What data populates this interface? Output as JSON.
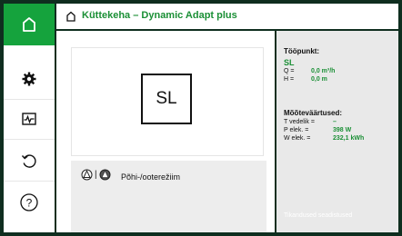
{
  "header": {
    "title": "Küttekeha – Dynamic Adapt plus",
    "icon": "house-icon"
  },
  "sidebar": {
    "items": [
      {
        "icon": "home-icon",
        "active": true
      },
      {
        "icon": "settings-gear-icon",
        "active": false
      },
      {
        "icon": "diagnostics-icon",
        "active": false
      },
      {
        "icon": "restore-icon",
        "active": false
      },
      {
        "icon": "help-icon",
        "active": false
      }
    ]
  },
  "main": {
    "mode_box": "SL",
    "pump_mode_label": "Põhi-/ooterežiim",
    "mode_separator": "|"
  },
  "panel": {
    "operating_point": {
      "title": "Tööpunkt:",
      "mode": "SL",
      "q_label": "Q =",
      "q_value": "0,0 m³/h",
      "h_label": "H =",
      "h_value": "0,0 m"
    },
    "measured": {
      "title": "Mõõteväärtused:",
      "t_label": "T vedelik =",
      "t_value": "–",
      "p_label": "P elek. =",
      "p_value": "398 W",
      "w_label": "W elek. =",
      "w_value": "232,1 kWh"
    },
    "footer_hint": "Tikandused seadistused"
  },
  "colors": {
    "accent": "#15a33d",
    "frame": "#0f2e1f",
    "panel": "#e9e9e9"
  }
}
